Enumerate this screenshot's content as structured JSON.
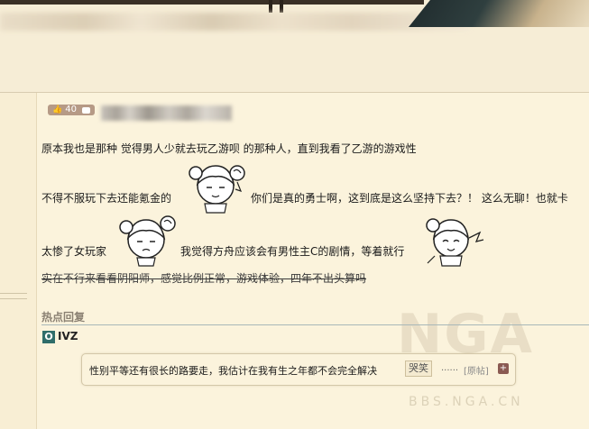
{
  "post": {
    "like_count": "40",
    "lines": [
      "原本我也是那种 觉得男人少就去玩乙游呗 的那种人，直到我看了乙游的游戏性",
      "不得不服玩下去还能氪金的",
      "你们是真的勇士啊，这到底是这么坚持下去？！ 这么无聊！也就卡",
      "太惨了女玩家",
      "我觉得方舟应该会有男性主C的剧情，等着就行",
      "实在不行来看看阴阳师，感觉比例正常，游戏体验，四年不出头算吗"
    ]
  },
  "hot_reply": {
    "title": "热点回复",
    "uid_badge": "O",
    "user": "IVZ",
    "text": "性别平等还有很长的路要走，我估计在我有生之年都不会完全解决",
    "emote": "哭笑",
    "ellipsis": "......",
    "orig_link": "[原帖]",
    "plus": "+"
  },
  "watermark": {
    "logo": "NGA",
    "site": "BBS.NGA.CN"
  },
  "icons": [
    "thumb-up-icon",
    "comment-icon",
    "sticker-face-icon"
  ],
  "colors": {
    "background": "#fbf3dc",
    "uid_badge": "#2f6d6a",
    "like_badge": "#b69a86",
    "plus_button": "#8a5a52"
  }
}
